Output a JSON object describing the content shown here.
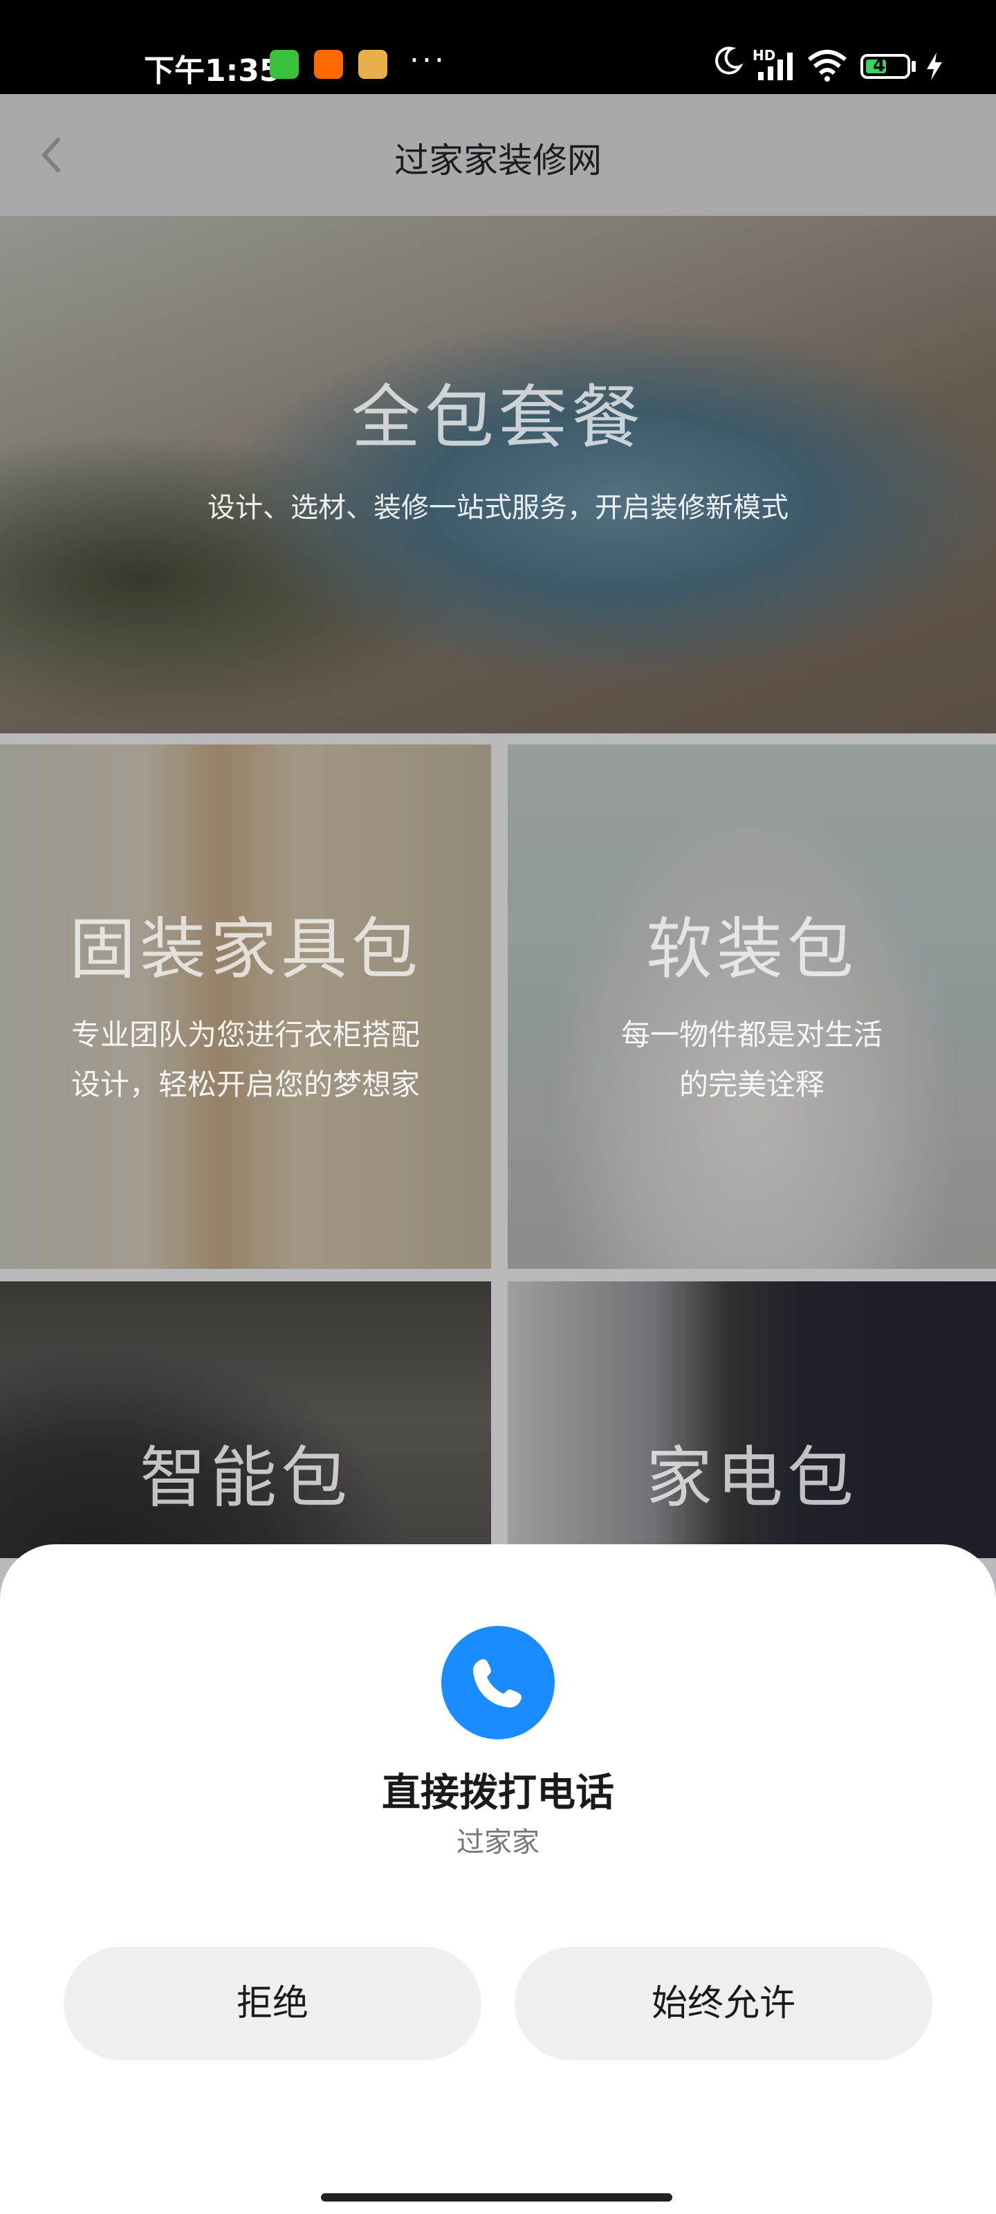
{
  "status_bar": {
    "time": "下午1:35",
    "hd_label": "HD",
    "battery": "46",
    "icons": [
      "app-green-icon",
      "app-orange-home-icon",
      "app-game-icon",
      "more-dots-icon",
      "moon-icon",
      "signal-icon",
      "wifi-icon",
      "battery-icon",
      "charging-icon"
    ]
  },
  "header": {
    "title": "过家家装修网",
    "back_icon": "chevron-left-icon"
  },
  "tiles": [
    {
      "heading": "全包套餐",
      "sub": "设计、选材、装修一站式服务，开启装修新模式"
    },
    {
      "heading": "固装家具包",
      "sub_line1": "专业团队为您进行衣柜搭配",
      "sub_line2": "设计，轻松开启您的梦想家"
    },
    {
      "heading": "软装包",
      "sub_line1": "每一物件都是对生活",
      "sub_line2": "的完美诠释"
    },
    {
      "heading": "智能包"
    },
    {
      "heading": "家电包"
    }
  ],
  "dialog": {
    "icon": "phone-icon",
    "title": "直接拨打电话",
    "subtitle": "过家家",
    "deny_label": "拒绝",
    "allow_label": "始终允许"
  },
  "colors": {
    "accent": "#1a8cff",
    "status_bar_bg": "#000000",
    "header_bg": "#a9a8ad",
    "button_bg": "#efefef"
  }
}
